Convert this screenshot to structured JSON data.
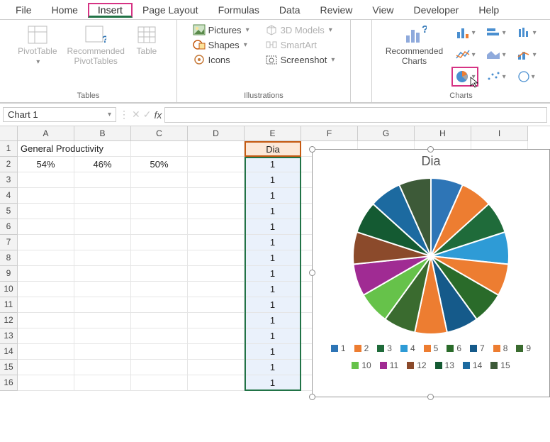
{
  "menu": {
    "file": "File",
    "home": "Home",
    "insert": "Insert",
    "page_layout": "Page Layout",
    "formulas": "Formulas",
    "data": "Data",
    "review": "Review",
    "view": "View",
    "developer": "Developer",
    "help": "Help"
  },
  "ribbon": {
    "tables": {
      "label": "Tables",
      "pivot": "PivotTable",
      "recpivot": "Recommended\nPivotTables",
      "table": "Table"
    },
    "illus": {
      "label": "Illustrations",
      "pictures": "Pictures",
      "shapes": "Shapes",
      "icons": "Icons",
      "models": "3D Models",
      "smartart": "SmartArt",
      "screenshot": "Screenshot"
    },
    "charts": {
      "label": "Charts",
      "rec": "Recommended\nCharts"
    }
  },
  "namebox": "Chart 1",
  "columns": [
    "A",
    "B",
    "C",
    "D",
    "E",
    "F",
    "G",
    "H",
    "I"
  ],
  "rows": [
    "1",
    "2",
    "3",
    "4",
    "5",
    "6",
    "7",
    "8",
    "9",
    "10",
    "11",
    "12",
    "13",
    "14",
    "15",
    "16"
  ],
  "a1": "General Productivity",
  "a2": "54%",
  "b2": "46%",
  "c2": "50%",
  "e_header": "Dia",
  "e_values": [
    "1",
    "1",
    "1",
    "1",
    "1",
    "1",
    "1",
    "1",
    "1",
    "1",
    "1",
    "1",
    "1",
    "1",
    "1"
  ],
  "chart_data": {
    "type": "pie",
    "title": "Dia",
    "categories": [
      "1",
      "2",
      "3",
      "4",
      "5",
      "6",
      "7",
      "8",
      "9",
      "10",
      "11",
      "12",
      "13",
      "14",
      "15"
    ],
    "values": [
      1,
      1,
      1,
      1,
      1,
      1,
      1,
      1,
      1,
      1,
      1,
      1,
      1,
      1,
      1
    ],
    "colors": [
      "#2e75b6",
      "#ed7d31",
      "#1f6b3a",
      "#2e9bd6",
      "#ed7d31",
      "#2a6b2a",
      "#155a8a",
      "#ed7d31",
      "#3a6b2f",
      "#66c24a",
      "#a02b93",
      "#8b4a2b",
      "#145a32",
      "#1c6aa0",
      "#3d5a38"
    ]
  }
}
